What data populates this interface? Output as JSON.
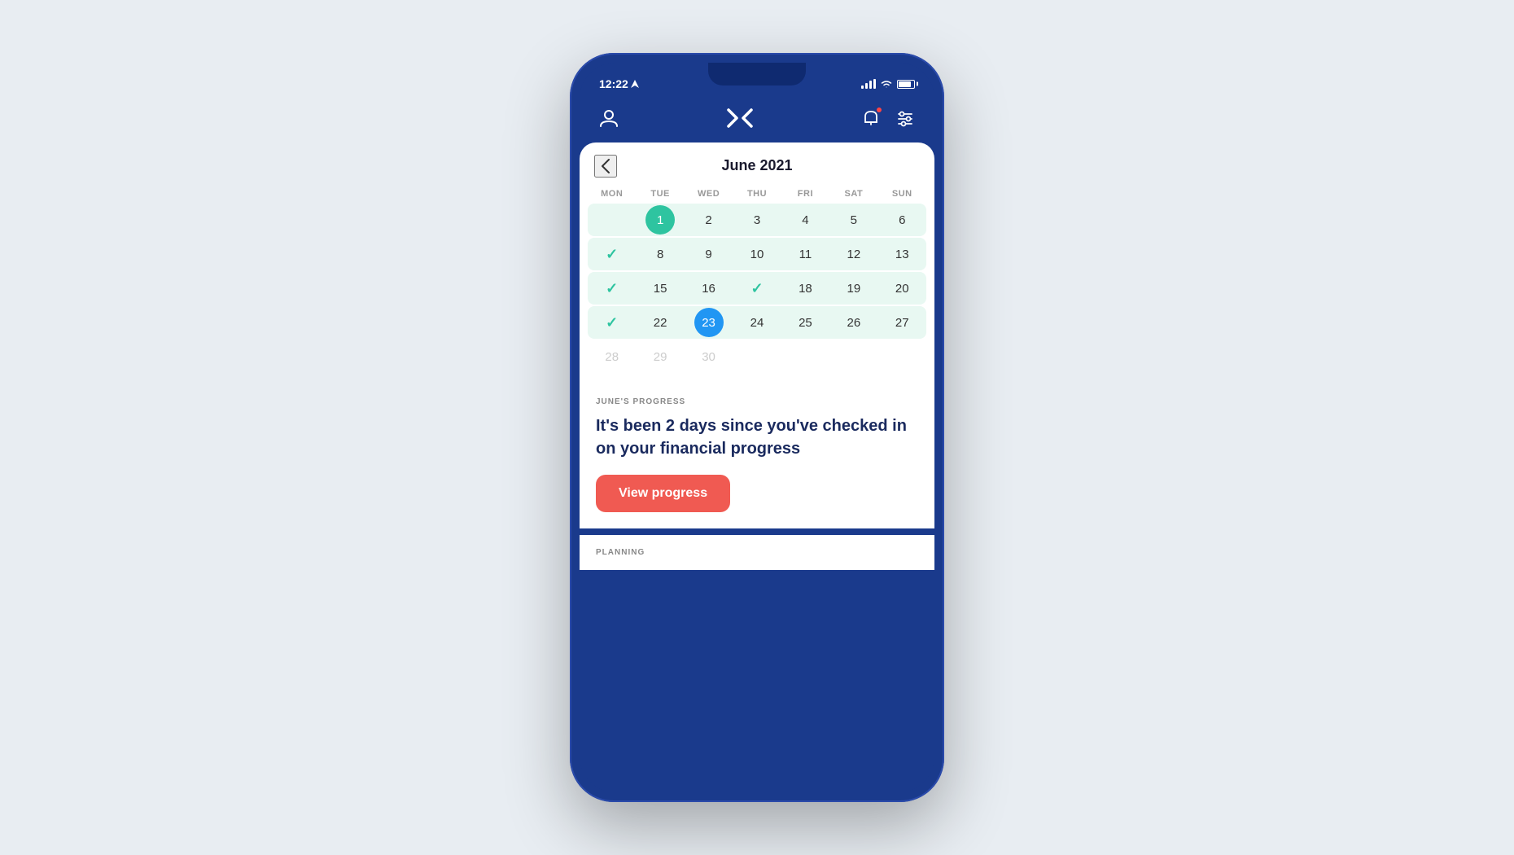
{
  "phone": {
    "status_bar": {
      "time": "12:22",
      "signal_label": "signal",
      "wifi_label": "wifi",
      "battery_label": "battery"
    },
    "nav": {
      "profile_icon": "person-icon",
      "logo_text": "✕",
      "notification_icon": "bell-icon",
      "filter_icon": "sliders-icon"
    },
    "calendar": {
      "back_label": "‹",
      "title": "June 2021",
      "day_headers": [
        "MON",
        "TUE",
        "WED",
        "THU",
        "FRI",
        "SAT",
        "SUN"
      ],
      "weeks": [
        [
          {
            "type": "empty",
            "value": ""
          },
          {
            "type": "highlight-circle",
            "value": "1"
          },
          {
            "type": "normal",
            "value": "2"
          },
          {
            "type": "normal",
            "value": "3"
          },
          {
            "type": "normal",
            "value": "4"
          },
          {
            "type": "normal",
            "value": "5"
          },
          {
            "type": "normal",
            "value": "6"
          }
        ],
        [
          {
            "type": "check",
            "value": "✓"
          },
          {
            "type": "normal",
            "value": "8"
          },
          {
            "type": "normal",
            "value": "9"
          },
          {
            "type": "normal",
            "value": "10"
          },
          {
            "type": "normal",
            "value": "11"
          },
          {
            "type": "normal",
            "value": "12"
          },
          {
            "type": "normal",
            "value": "13"
          }
        ],
        [
          {
            "type": "check",
            "value": "✓"
          },
          {
            "type": "normal",
            "value": "15"
          },
          {
            "type": "normal",
            "value": "16"
          },
          {
            "type": "check",
            "value": "✓"
          },
          {
            "type": "normal",
            "value": "18"
          },
          {
            "type": "normal",
            "value": "19"
          },
          {
            "type": "normal",
            "value": "20"
          }
        ],
        [
          {
            "type": "check",
            "value": "✓"
          },
          {
            "type": "normal",
            "value": "22"
          },
          {
            "type": "current-circle",
            "value": "23"
          },
          {
            "type": "normal",
            "value": "24"
          },
          {
            "type": "normal",
            "value": "25"
          },
          {
            "type": "normal",
            "value": "26"
          },
          {
            "type": "normal",
            "value": "27"
          }
        ],
        [
          {
            "type": "muted",
            "value": "28"
          },
          {
            "type": "muted",
            "value": "29"
          },
          {
            "type": "muted",
            "value": "30"
          },
          {
            "type": "empty",
            "value": ""
          },
          {
            "type": "empty",
            "value": ""
          },
          {
            "type": "empty",
            "value": ""
          },
          {
            "type": "empty",
            "value": ""
          }
        ]
      ]
    },
    "progress": {
      "section_label": "JUNE'S PROGRESS",
      "message": "It's been 2 days since you've checked in on your financial progress",
      "button_label": "View progress"
    },
    "planning": {
      "section_label": "PLANNING"
    }
  }
}
